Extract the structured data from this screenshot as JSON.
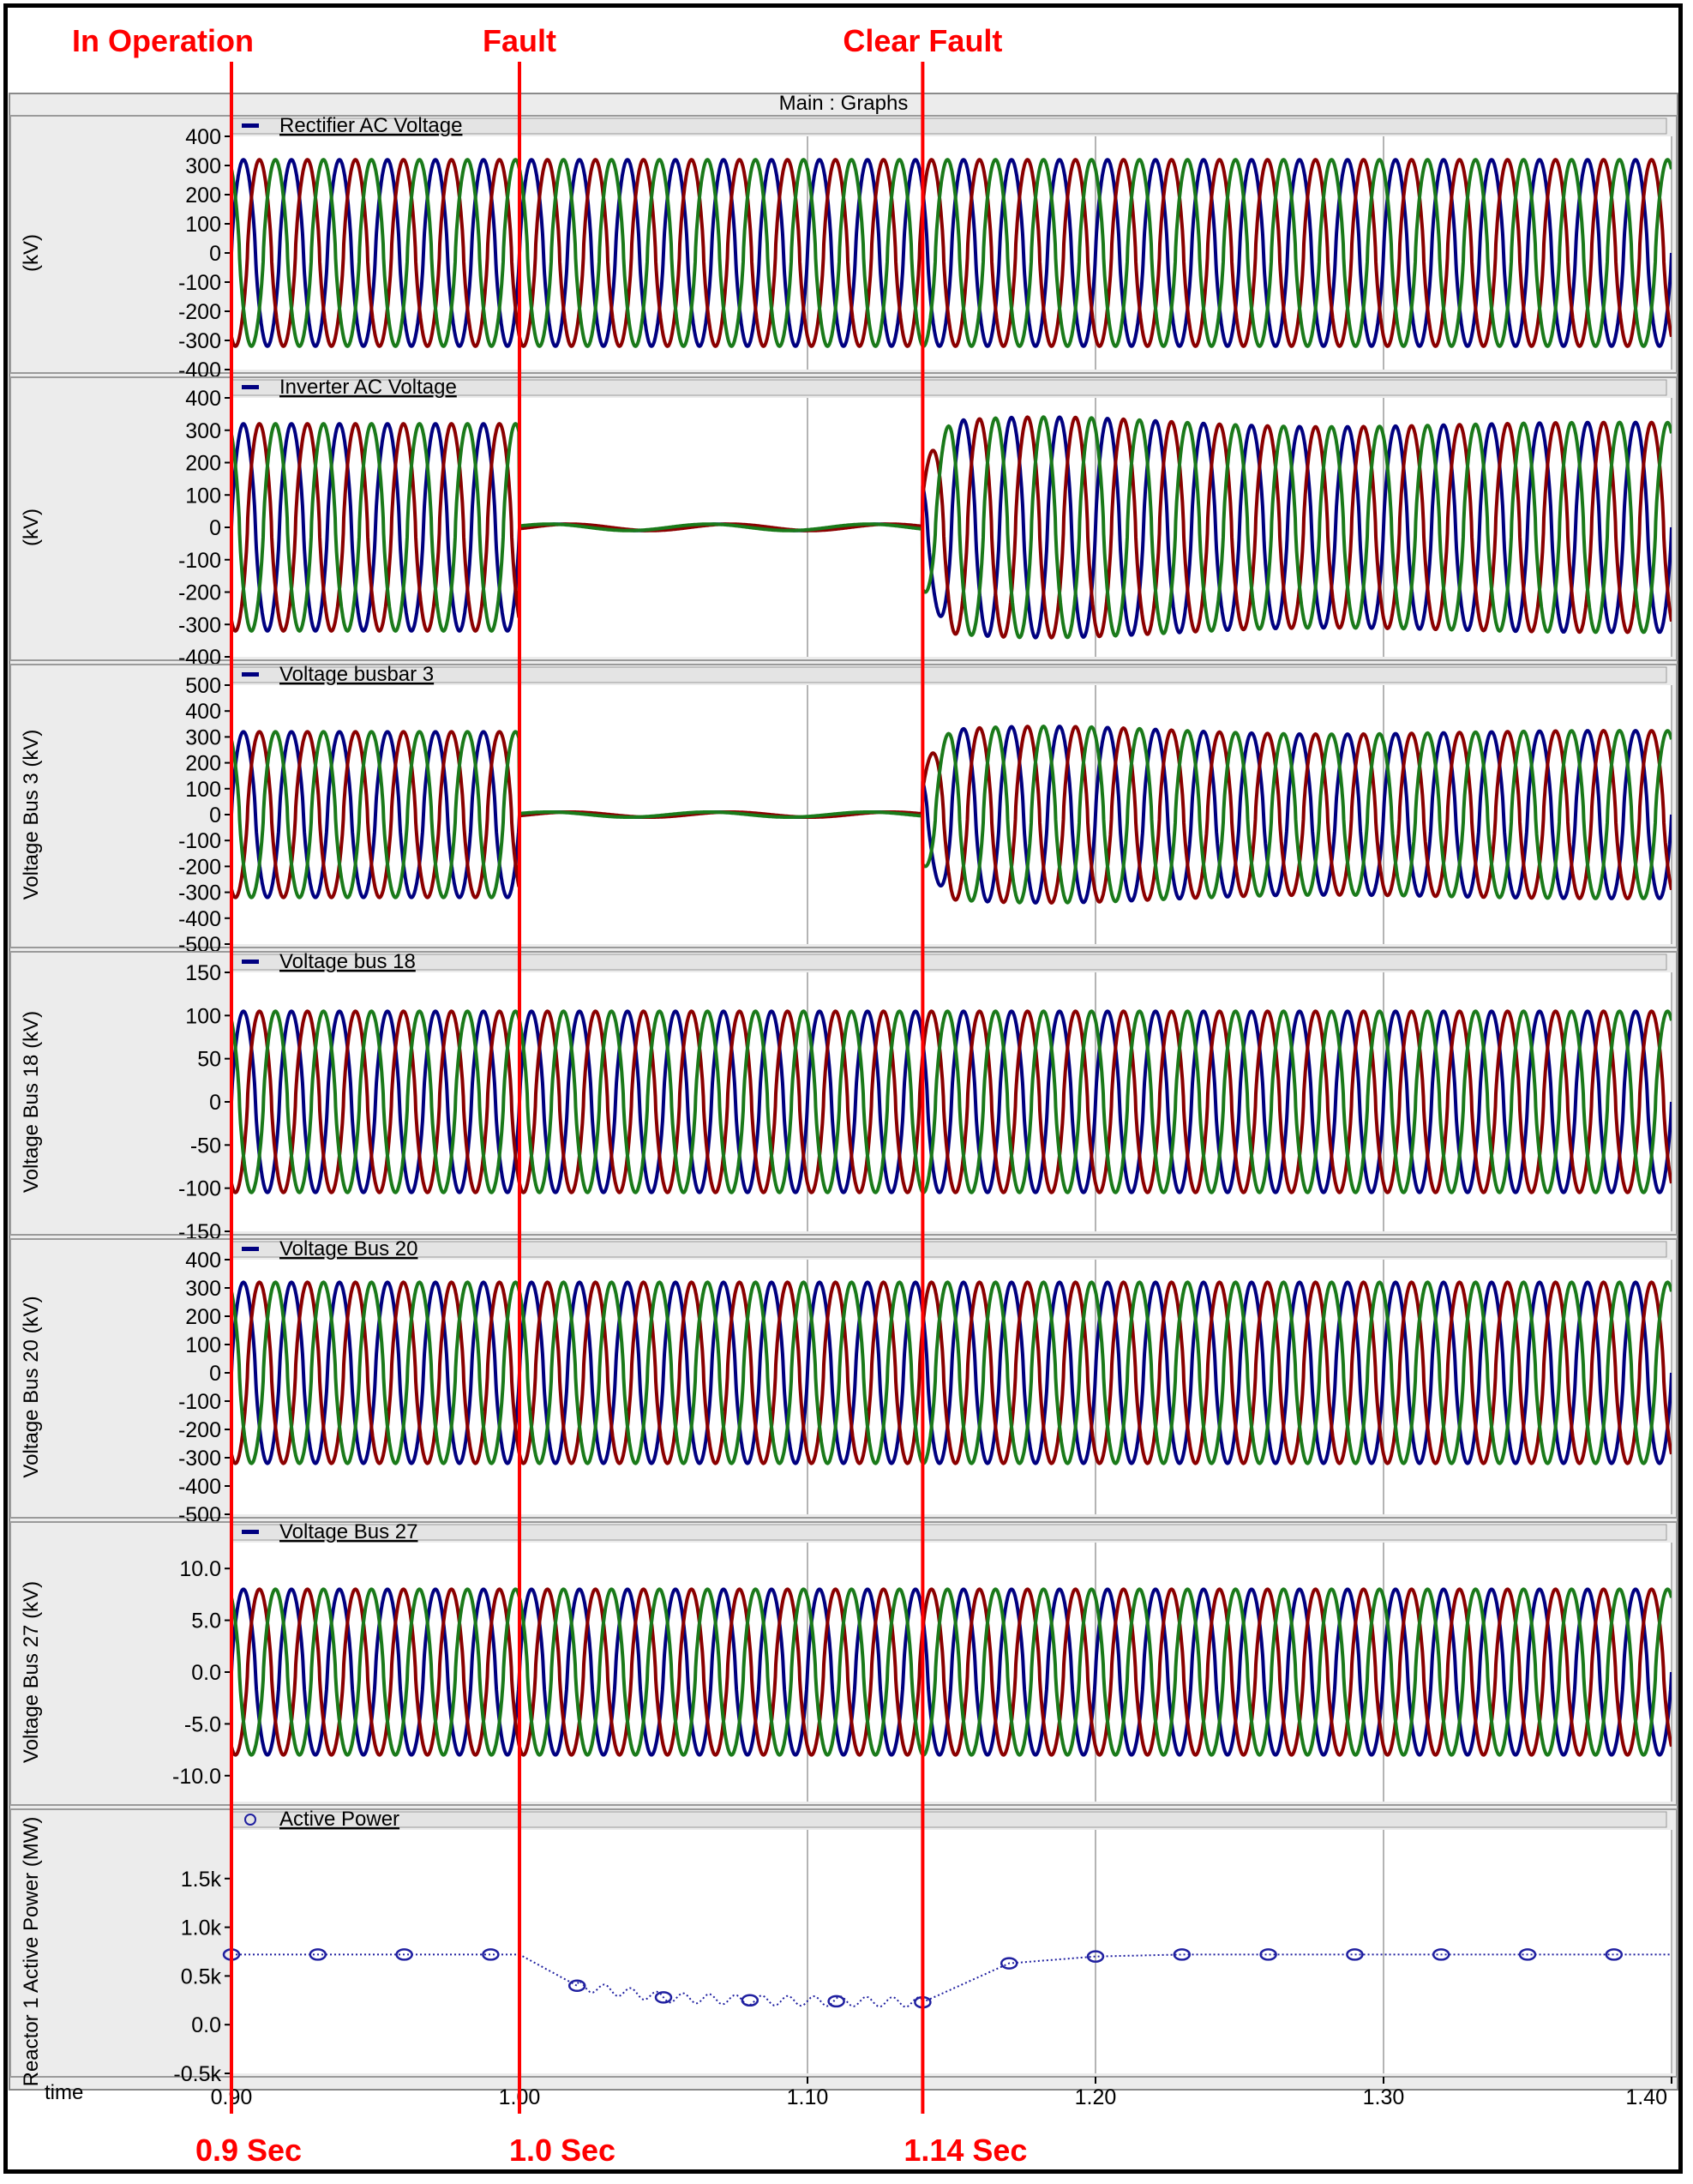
{
  "window": {
    "title": "Main : Graphs"
  },
  "markers": [
    {
      "event_label": "In Operation",
      "time_label": "0.9 Sec",
      "t": 0.9
    },
    {
      "event_label": "Fault",
      "time_label": "1.0 Sec",
      "t": 1.0
    },
    {
      "event_label": "Clear Fault",
      "time_label": "1.14 Sec",
      "t": 1.14
    }
  ],
  "x_axis": {
    "label": "time",
    "ticks": [
      "0.90",
      "1.00",
      "1.10",
      "1.20",
      "1.30",
      "1.40"
    ],
    "range": [
      0.9,
      1.4
    ]
  },
  "colors": {
    "marker": "#ff0000",
    "phase_a": "#000080",
    "phase_b": "#8b0000",
    "phase_c": "#1a7a1a",
    "power": "#2020a0"
  },
  "chart_data": [
    {
      "type": "line",
      "title": "Rectifier AC Voltage",
      "ylabel": "(kV)",
      "ylim": [
        -400,
        400
      ],
      "yticks": [
        "400",
        "300",
        "200",
        "100",
        "0",
        "-100",
        "-200",
        "-300",
        "-400"
      ],
      "series": [],
      "phases": {
        "amplitude": 320,
        "freq_hz": 60,
        "fault": false
      }
    },
    {
      "type": "line",
      "title": "Inverter AC Voltage",
      "ylabel": "(kV)",
      "ylim": [
        -400,
        400
      ],
      "yticks": [
        "400",
        "300",
        "200",
        "100",
        "0",
        "-100",
        "-200",
        "-300",
        "-400"
      ],
      "series": [],
      "phases": {
        "amplitude": 320,
        "freq_hz": 60,
        "fault": true,
        "fault_start": 1.0,
        "fault_clear": 1.14,
        "fault_amplitude": 10,
        "post_overshoot": 30
      }
    },
    {
      "type": "line",
      "title": "Voltage busbar 3",
      "ylabel": "Voltage Bus 3 (kV)",
      "ylim": [
        -500,
        500
      ],
      "yticks": [
        "500",
        "400",
        "300",
        "200",
        "100",
        "0",
        "-100",
        "-200",
        "-300",
        "-400",
        "-500"
      ],
      "series": [],
      "phases": {
        "amplitude": 320,
        "freq_hz": 60,
        "fault": true,
        "fault_start": 1.0,
        "fault_clear": 1.14,
        "fault_amplitude": 10,
        "post_overshoot": 30
      }
    },
    {
      "type": "line",
      "title": "Voltage bus 18",
      "ylabel": "Voltage Bus 18 (kV)",
      "ylim": [
        -150,
        150
      ],
      "yticks": [
        "150",
        "100",
        "50",
        "0",
        "-50",
        "-100",
        "-150"
      ],
      "series": [],
      "phases": {
        "amplitude": 105,
        "freq_hz": 60,
        "fault": false
      }
    },
    {
      "type": "line",
      "title": "Voltage Bus 20",
      "ylabel": "Voltage Bus 20 (kV)",
      "ylim": [
        -500,
        400
      ],
      "yticks": [
        "400",
        "300",
        "200",
        "100",
        "0",
        "-100",
        "-200",
        "-300",
        "-400",
        "-500"
      ],
      "series": [],
      "phases": {
        "amplitude": 320,
        "freq_hz": 60,
        "fault": false
      }
    },
    {
      "type": "line",
      "title": "Voltage Bus 27",
      "ylabel": "Voltage Bus 27 (kV)",
      "ylim": [
        -12.5,
        12.5
      ],
      "yticks": [
        "10.0",
        "5.0",
        "0.0",
        "-5.0",
        "-10.0"
      ],
      "ytick_values": [
        10,
        5,
        0,
        -5,
        -10
      ],
      "series": [],
      "phases": {
        "amplitude": 8,
        "freq_hz": 60,
        "fault": false
      }
    },
    {
      "type": "line",
      "title": "Active Power",
      "ylabel": "Reactor 1 Active Power (MW)",
      "ylim": [
        -0.5,
        2.0
      ],
      "yticks": [
        "1.5k",
        "1.0k",
        "0.5k",
        "0.0",
        "-0.5k"
      ],
      "ytick_values": [
        1.5,
        1.0,
        0.5,
        0.0,
        -0.5
      ],
      "series": [
        {
          "name": "Active Power",
          "x": [
            0.9,
            0.93,
            0.96,
            0.99,
            1.0,
            1.02,
            1.05,
            1.08,
            1.11,
            1.14,
            1.17,
            1.2,
            1.23,
            1.26,
            1.29,
            1.32,
            1.35,
            1.38,
            1.4
          ],
          "values": [
            0.72,
            0.72,
            0.72,
            0.72,
            0.72,
            0.4,
            0.28,
            0.25,
            0.24,
            0.23,
            0.63,
            0.7,
            0.72,
            0.72,
            0.72,
            0.72,
            0.72,
            0.72,
            0.72
          ],
          "marker_x": [
            0.9,
            0.93,
            0.96,
            0.99,
            1.02,
            1.05,
            1.08,
            1.11,
            1.14,
            1.17,
            1.2,
            1.23,
            1.26,
            1.29,
            1.32,
            1.35,
            1.38
          ]
        }
      ]
    }
  ]
}
